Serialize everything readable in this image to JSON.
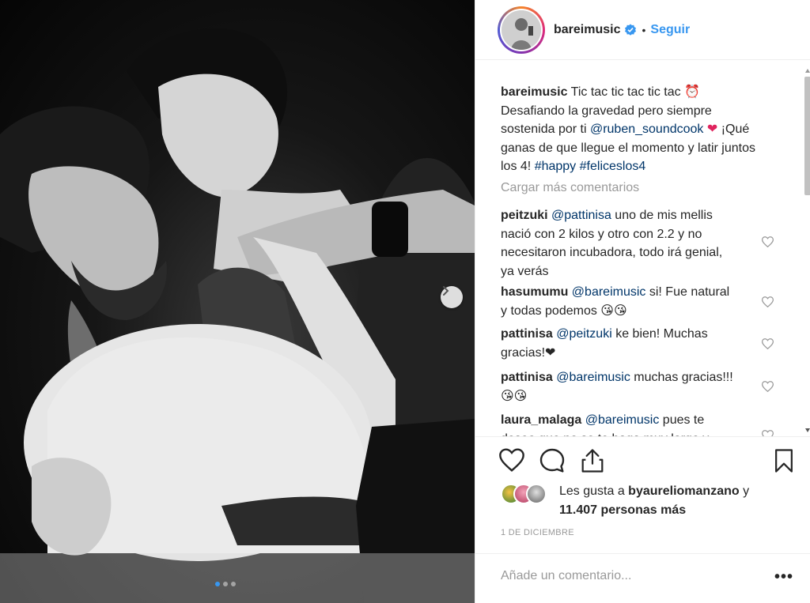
{
  "post": {
    "username": "bareimusic",
    "separator": "•",
    "follow_label": "Seguir",
    "caption": {
      "username": "bareimusic",
      "text_1": " Tic tac tic tac tic tac ",
      "clock_emoji": "⏰",
      "text_2": " Desafiando la gravedad pero siempre sostenida por ti ",
      "mention": "@ruben_soundcook",
      "heart": " ❤",
      "text_3": " ¡Qué ganas de que llegue el momento y latir juntos los 4! ",
      "tag1": "#happy",
      "tag2": "#feliceslos4"
    },
    "load_more": "Cargar más comentarios",
    "comments": [
      {
        "user": "peitzuki",
        "mention": "@pattinisa",
        "text": " uno de mis mellis nació con 2 kilos y otro con 2.2 y no necesitaron incubadora, todo irá genial, ya verás"
      },
      {
        "user": "hasumumu",
        "mention": "@bareimusic",
        "text": " si! Fue natural y todas podemos 😘😘"
      },
      {
        "user": "pattinisa",
        "mention": "@peitzuki",
        "text": " ke bien! Muchas gracias!❤"
      },
      {
        "user": "pattinisa",
        "mention": "@bareimusic",
        "text": " muchas gracias!!!😘😘"
      },
      {
        "user": "laura_malaga",
        "mention": "@bareimusic",
        "text": " pues te deseo que no se te haga muy largo y"
      }
    ],
    "likes": {
      "prefix": "Les gusta a ",
      "user": "byaureliomanzano",
      "middle": " y ",
      "count": "11.407 personas más"
    },
    "date": "1 DE DICIEMBRE",
    "add_comment_placeholder": "Añade un comentario...",
    "more_options": "•••"
  },
  "icons": {
    "verified": "verified-badge-icon",
    "like": "heart-outline-icon",
    "comment": "comment-bubble-icon",
    "share": "share-upload-icon",
    "save": "bookmark-icon",
    "next": "chevron-right-icon"
  },
  "colors": {
    "link": "#003569",
    "accent": "#3897f0",
    "muted": "#999999"
  }
}
